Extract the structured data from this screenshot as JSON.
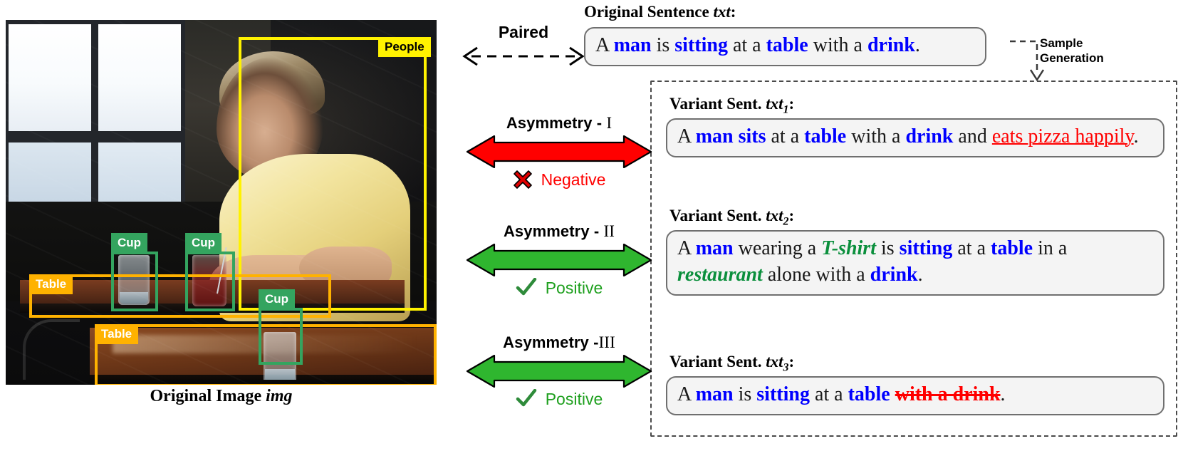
{
  "image_panel": {
    "caption_prefix": "Original Image ",
    "caption_italic": "img",
    "boxes": [
      {
        "label": "People",
        "type": "people"
      },
      {
        "label": "Cup",
        "type": "cup"
      },
      {
        "label": "Cup",
        "type": "cup"
      },
      {
        "label": "Cup",
        "type": "cup"
      },
      {
        "label": "Table",
        "type": "table"
      },
      {
        "label": "Table",
        "type": "table"
      }
    ],
    "box_colors": {
      "people": "#FFF200",
      "table": "#FFB200",
      "cup": "#34A45F"
    }
  },
  "paired": {
    "label": "Paired"
  },
  "sample_generation": {
    "line1": "Sample",
    "line2": "Generation"
  },
  "original_sentence": {
    "title_prefix": "Original Sentence ",
    "title_italic": "txt",
    "title_suffix": ":",
    "text_html": "A <span class=\"b\">man</span> is <span class=\"b\">sitting</span> at a <span class=\"b\">table</span> with a <span class=\"b\">drink</span>.",
    "plain": "A man is sitting at a table with a drink."
  },
  "asymmetries": [
    {
      "title_prefix": "Asymmetry - ",
      "numeral": "I",
      "verdict": "Negative",
      "verdict_type": "negative",
      "verdict_icon": "cross-icon",
      "arrow_color": "#FF0000",
      "arrow_direction": "both"
    },
    {
      "title_prefix": "Asymmetry - ",
      "numeral": "II",
      "verdict": "Positive",
      "verdict_type": "positive",
      "verdict_icon": "check-icon",
      "arrow_color": "#2FB62F",
      "arrow_direction": "both"
    },
    {
      "title_prefix": "Asymmetry -",
      "numeral": "III",
      "verdict": "Positive",
      "verdict_type": "positive",
      "verdict_icon": "check-icon",
      "arrow_color": "#2FB62F",
      "arrow_direction": "both"
    }
  ],
  "variants": [
    {
      "title_prefix": "Variant Sent. ",
      "title_italic": "txt",
      "title_sub": "1",
      "title_suffix": ":",
      "text_html": "A <span class=\"b\">man sits</span> at a <span class=\"b\">table</span> with a <span class=\"b\">drink</span> and <span class=\"r-und\">eats pizza happily</span>.",
      "plain": "A man sits at a table with a drink and eats pizza happily."
    },
    {
      "title_prefix": "Variant Sent. ",
      "title_italic": "txt",
      "title_sub": "2",
      "title_suffix": ":",
      "text_html": "A <span class=\"b\">man</span> wearing a <span class=\"g\">T-shirt</span> is <span class=\"b\">sitting</span> at a <span class=\"b\">table</span> in a <span class=\"g\">restaurant</span> alone with a <span class=\"b\">drink</span>.",
      "plain": "A man wearing a T-shirt is sitting at a table in a restaurant alone with a drink."
    },
    {
      "title_prefix": "Variant Sent. ",
      "title_italic": "txt",
      "title_sub": "3",
      "title_suffix": ":",
      "text_html": "A <span class=\"b\">man</span> is <span class=\"b\">sitting</span> at a <span class=\"b\">table</span> <span class=\"r-str\">with a drink</span>.",
      "plain": "A man is sitting at a table with a drink."
    }
  ],
  "colors": {
    "concept_blue": "#0000FF",
    "added_green": "#0A8F3C",
    "negative_red": "#FF0000",
    "positive_green": "#1FA01F"
  }
}
